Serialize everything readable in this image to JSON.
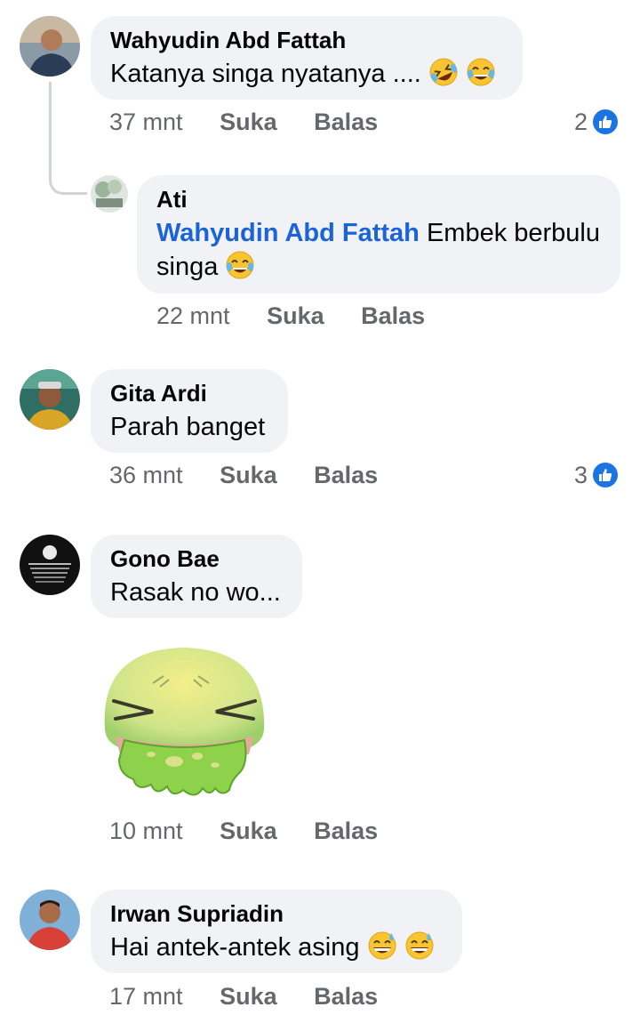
{
  "comments": [
    {
      "author": "Wahyudin Abd Fattah",
      "text": "Katanya singa nyatanya ....",
      "emojis": [
        "rolling-laugh-emoji",
        "tears-of-joy-emoji"
      ],
      "time": "37 mnt",
      "like_label": "Suka",
      "reply_label": "Balas",
      "likes": "2"
    },
    {
      "author": "Ati",
      "mention": "Wahyudin Abd Fattah",
      "text": " Embek berbulu singa",
      "emojis": [
        "tears-of-joy-emoji"
      ],
      "time": "22 mnt",
      "like_label": "Suka",
      "reply_label": "Balas"
    },
    {
      "author": "Gita Ardi",
      "text": "Parah banget",
      "time": "36 mnt",
      "like_label": "Suka",
      "reply_label": "Balas",
      "likes": "3"
    },
    {
      "author": "Gono Bae",
      "text": "Rasak no wo...",
      "sticker": "vomiting-face-sticker",
      "time": "10 mnt",
      "like_label": "Suka",
      "reply_label": "Balas"
    },
    {
      "author": "Irwan Supriadin",
      "text": "Hai antek-antek asing",
      "emojis": [
        "grinning-sweat-emoji",
        "grinning-sweat-emoji"
      ],
      "time": "17 mnt",
      "like_label": "Suka",
      "reply_label": "Balas"
    }
  ],
  "colors": {
    "bubble": "#f0f2f5",
    "meta_text": "#65676b",
    "mention": "#1b63d8",
    "like_badge": "#1b74e4"
  }
}
